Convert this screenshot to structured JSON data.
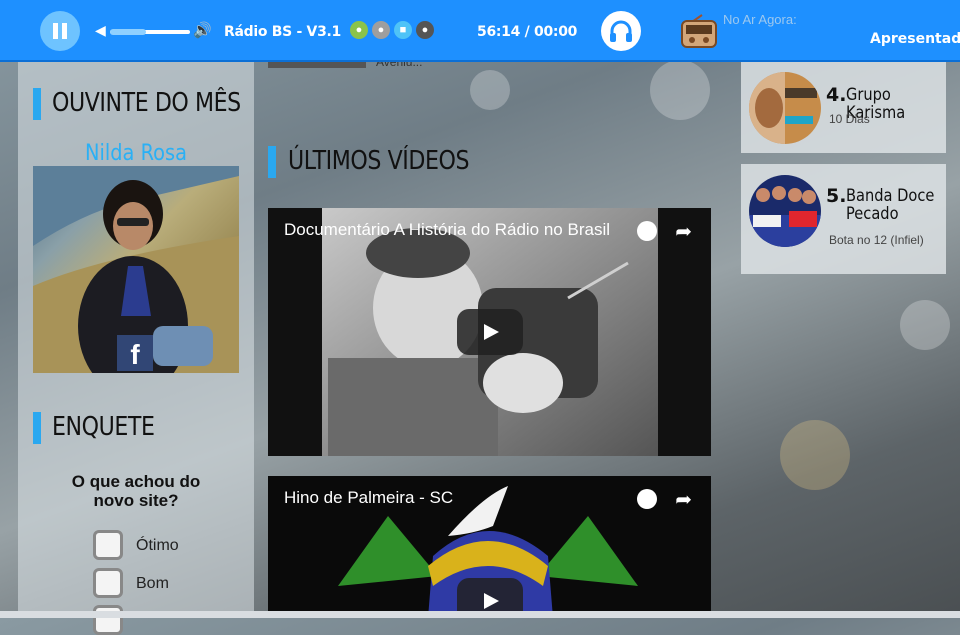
{
  "player": {
    "station": "Rádio BS - V3.1",
    "time": "56:14 / 00:00",
    "on_air_label": "No Ar Agora:",
    "presenter_label": "Apresentador:",
    "volume_level": 0.45,
    "app_icons": [
      "android-icon",
      "apple-icon",
      "windows-icon",
      "blackberry-icon"
    ]
  },
  "left": {
    "listener_title": "OUVINTE DO MÊS",
    "listener_name": "Nilda Rosa",
    "poll_title": "ENQUETE",
    "poll_question": "O que achou do novo site?",
    "poll_options": [
      "Ótimo",
      "Bom"
    ]
  },
  "middle": {
    "top_partial_text": "Aveniu...",
    "videos_title": "ÚLTIMOS VÍDEOS",
    "videos": [
      {
        "title": "Documentário A História do Rádio no Brasil"
      },
      {
        "title": "Hino de Palmeira - SC"
      }
    ]
  },
  "right": {
    "ranking": [
      {
        "number": "4.",
        "name": "Grupo Karisma",
        "sub": "10 Dias"
      },
      {
        "number": "5.",
        "name": "Banda Doce Pecado",
        "sub": "Bota no 12 (Infiel)"
      }
    ]
  },
  "colors": {
    "topbar": "#1e90ff",
    "accent": "#2aa8f0",
    "listener_name": "#2ab0f5"
  }
}
